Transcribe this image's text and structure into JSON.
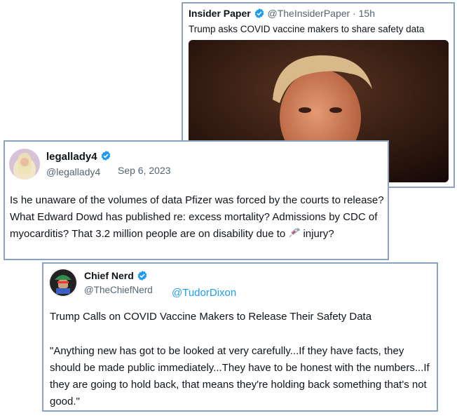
{
  "card1": {
    "name": "Insider Paper",
    "handle_time": "@TheInsiderPaper · 15h",
    "headline": "Trump asks COVID vaccine makers to share safety data"
  },
  "card2": {
    "name": "legallady4",
    "handle": "@legallady4",
    "date": "Sep 6, 2023",
    "body_pre": "Is he unaware of the volumes of data Pfizer was forced by the courts to release? What Edward Dowd has published re: excess mortality? Admissions by CDC of myocarditis? That 3.2 million people are on disability due to ",
    "body_post": "injury?"
  },
  "card3": {
    "name": "Chief Nerd",
    "handle": "@TheChiefNerd",
    "mention": "@TudorDixon",
    "line1": "Trump Calls on COVID Vaccine Makers to Release Their Safety Data",
    "quote": "\"Anything new has got to be looked at very carefully...If they have facts, they should be made public immediately...They have to be honest with the numbers...If they are going to hold back, that means they're holding back something that's not good.\""
  },
  "colors": {
    "border": "#8aa3c4",
    "verified": "#1d9bf0",
    "link": "#1d9bf0",
    "muted": "#536471"
  },
  "icons": [
    "verified-badge-icon",
    "syringe-icon"
  ]
}
